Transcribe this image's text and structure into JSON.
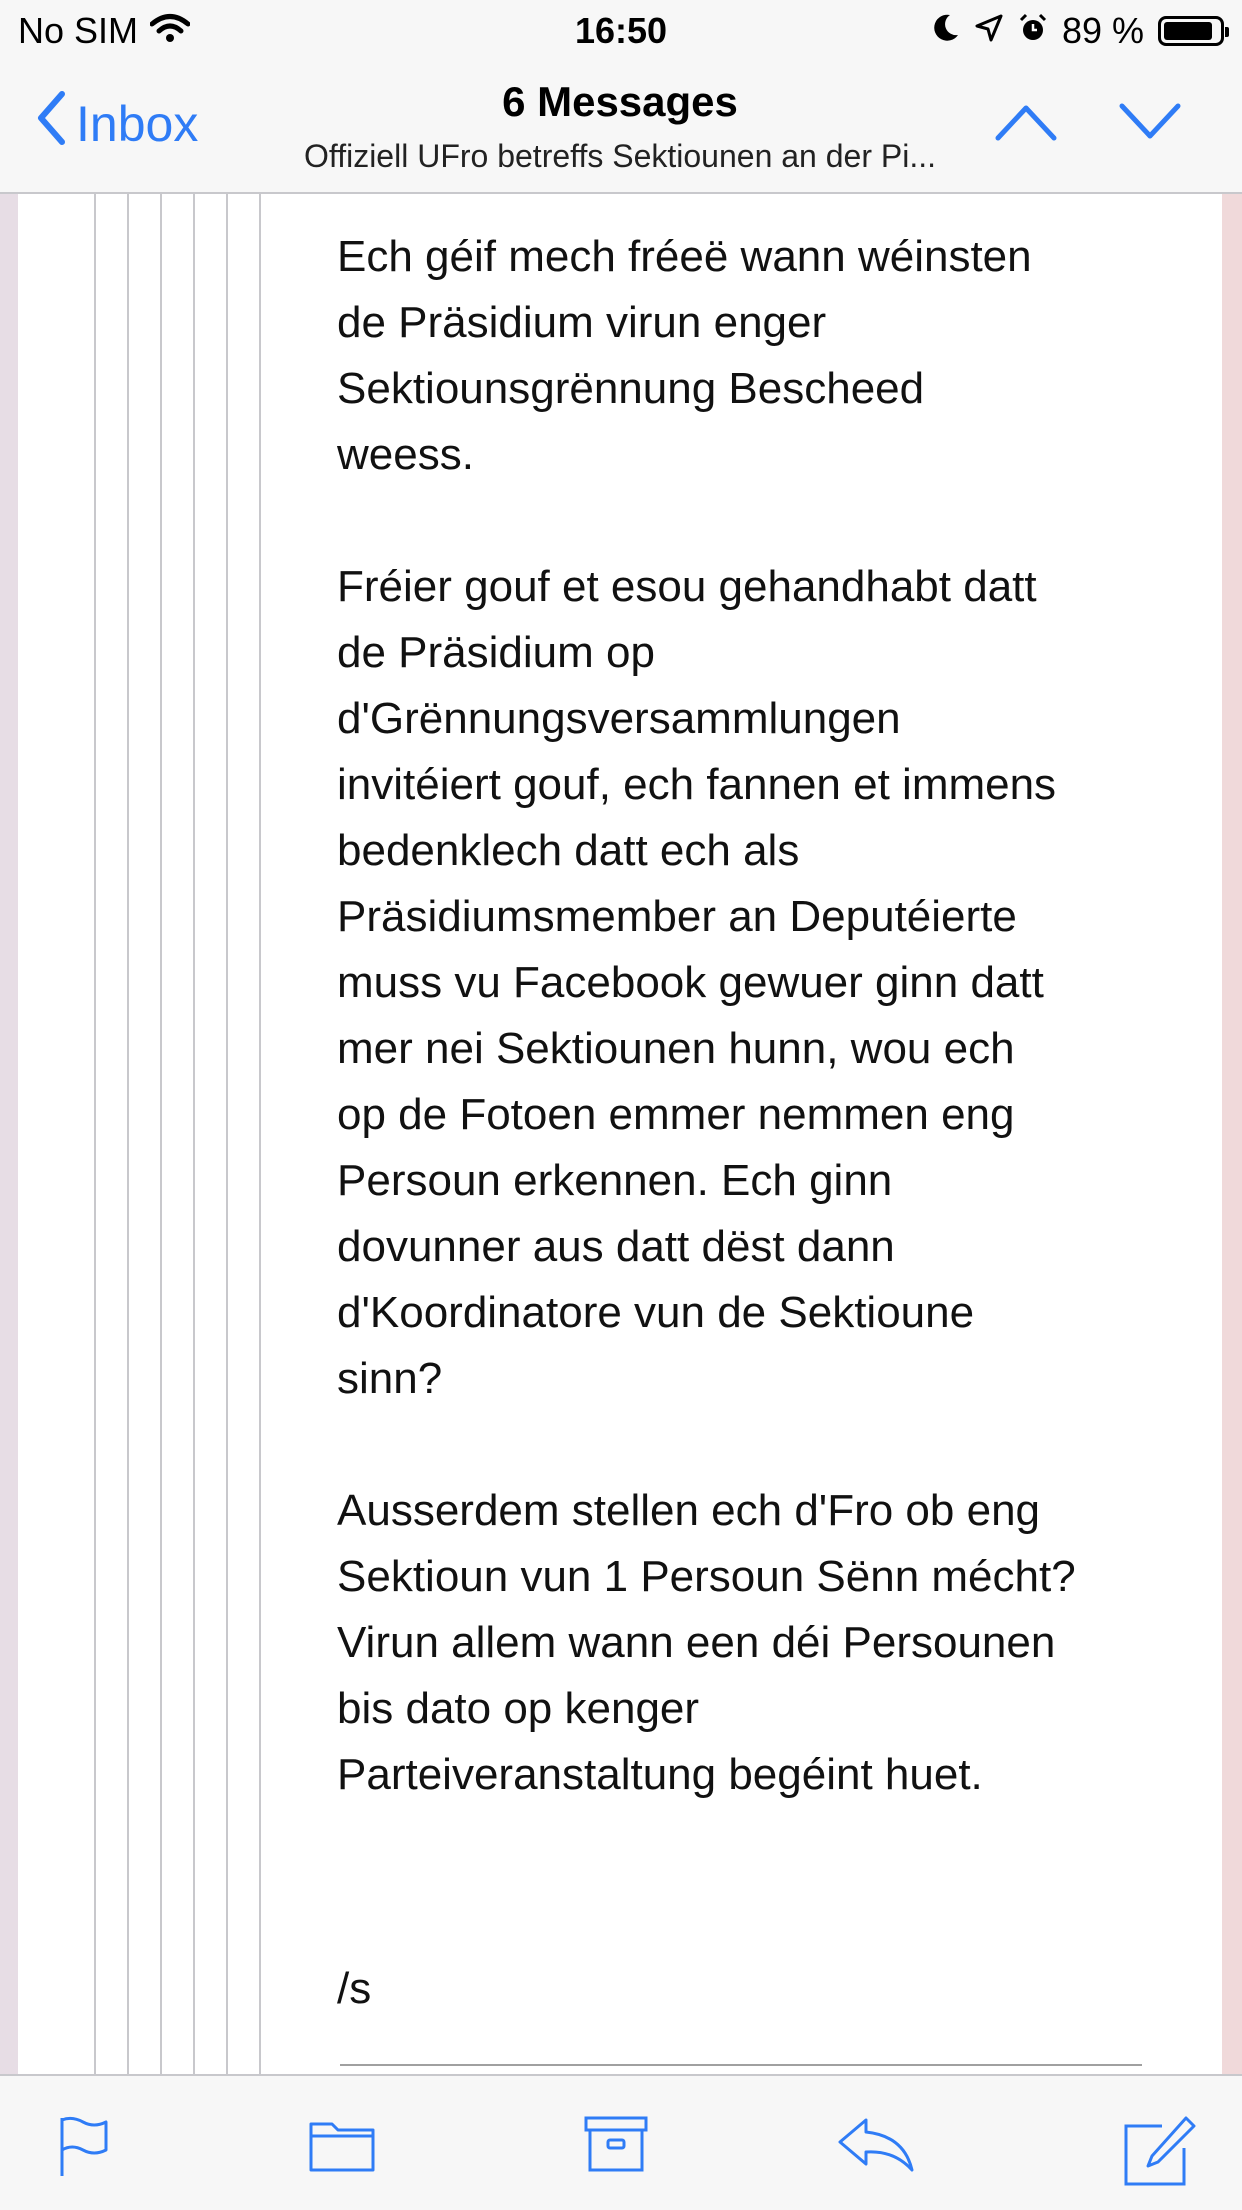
{
  "status_bar": {
    "carrier": "No SIM",
    "time": "16:50",
    "battery_percent": "89 %",
    "battery_level": 0.89,
    "icons": [
      "wifi-icon",
      "moon-icon",
      "location-icon",
      "alarm-icon",
      "battery-icon"
    ]
  },
  "nav": {
    "back_label": "Inbox",
    "title": "6 Messages",
    "subtitle": "Offiziell UFro betreffs Sektiounen an der Pi..."
  },
  "message": {
    "paragraphs": [
      "Ech géif mech fréeë wann wéinsten\nde Präsidium virun enger\nSektiounsgrënnung Bescheed\nweess.",
      "Fréier gouf et esou gehandhabt datt\nde Präsidium op\nd'Grënnungsversammlungen\ninvitéiert gouf, ech fannen et immens\nbedenklech datt ech als\nPräsidiumsmember an Deputéierte\nmuss vu Facebook gewuer ginn datt\nmer nei Sektiounen hunn, wou ech\nop de Fotoen emmer nemmen eng\nPersoun erkennen. Ech ginn\ndovunner aus datt dëst dann\nd'Koordinatore vun de Sektioune\nsinn?",
      "Ausserdem stellen ech d'Fro ob eng\nSektioun vun 1 Persoun Sënn mécht?\nVirun allem wann een déi Persounen\nbis dato op kenger\nParteiveranstaltung begéint huet."
    ],
    "signature": "/s"
  },
  "toolbar": {
    "icons": [
      "flag-icon",
      "folder-icon",
      "archive-icon",
      "reply-icon",
      "compose-icon"
    ]
  },
  "colors": {
    "accent": "#2f7cf6",
    "bar_background": "#f7f7f7",
    "separator": "#c8c8cc"
  }
}
